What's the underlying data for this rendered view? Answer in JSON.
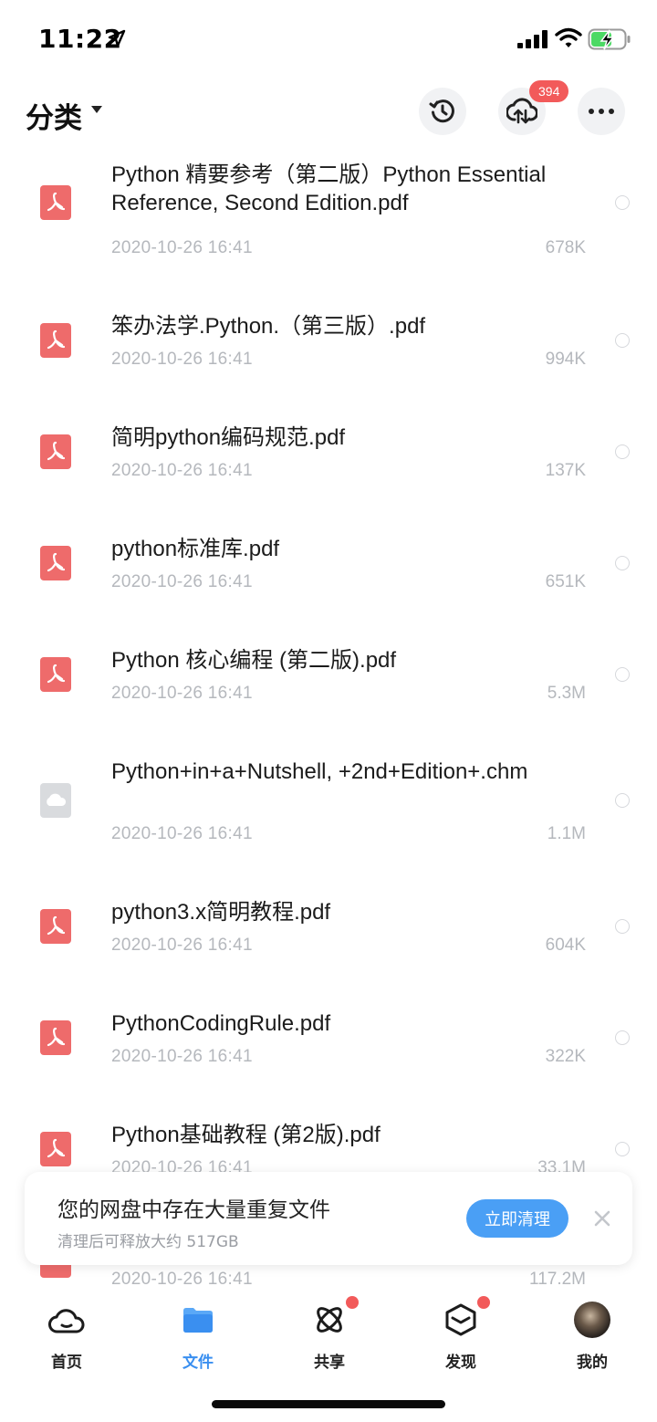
{
  "status_bar": {
    "time": "11:22"
  },
  "header": {
    "title": "分类",
    "cloud_badge": "394"
  },
  "files": [
    {
      "name": "Python 精要参考（第二版）Python Essential Reference, Second Edition.pdf",
      "date": "2020-10-26 16:41",
      "size": "678K",
      "type": "pdf"
    },
    {
      "name": "笨办法学.Python.（第三版）.pdf",
      "date": "2020-10-26 16:41",
      "size": "994K",
      "type": "pdf"
    },
    {
      "name": "简明python编码规范.pdf",
      "date": "2020-10-26 16:41",
      "size": "137K",
      "type": "pdf"
    },
    {
      "name": "python标准库.pdf",
      "date": "2020-10-26 16:41",
      "size": "651K",
      "type": "pdf"
    },
    {
      "name": "Python 核心编程 (第二版).pdf",
      "date": "2020-10-26 16:41",
      "size": "5.3M",
      "type": "pdf"
    },
    {
      "name": "Python+in+a+Nutshell, +2nd+Edition+.chm",
      "date": "2020-10-26 16:41",
      "size": "1.1M",
      "type": "chm"
    },
    {
      "name": "python3.x简明教程.pdf",
      "date": "2020-10-26 16:41",
      "size": "604K",
      "type": "pdf"
    },
    {
      "name": "PythonCodingRule.pdf",
      "date": "2020-10-26 16:41",
      "size": "322K",
      "type": "pdf"
    },
    {
      "name": "Python基础教程 (第2版).pdf",
      "date": "2020-10-26 16:41",
      "size": "33.1M",
      "type": "pdf"
    },
    {
      "name": "",
      "date": "2020-10-26 16:41",
      "size": "117.2M",
      "type": "pdf"
    }
  ],
  "notice": {
    "title": "您的网盘中存在大量重复文件",
    "subtitle": "清理后可释放大约 517GB",
    "button": "立即清理"
  },
  "tabs": [
    {
      "label": "首页",
      "icon": "home-cloud-icon"
    },
    {
      "label": "文件",
      "icon": "folder-icon"
    },
    {
      "label": "共享",
      "icon": "share-orbit-icon"
    },
    {
      "label": "发现",
      "icon": "discover-box-icon"
    },
    {
      "label": "我的",
      "icon": "avatar"
    }
  ],
  "colors": {
    "accent": "#3a8ff0",
    "pdf_icon": "#ee6b6b",
    "badge": "#f25a5a",
    "muted_text": "#b5b8bd"
  }
}
